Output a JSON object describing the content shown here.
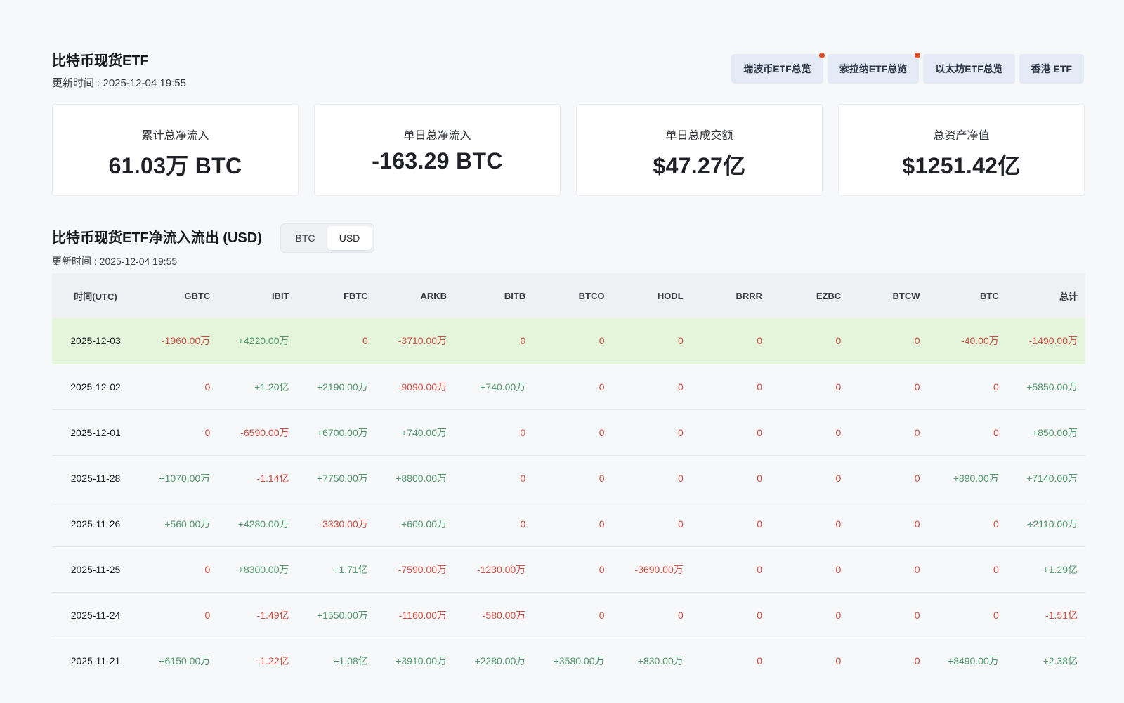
{
  "header": {
    "title": "比特币现货ETF",
    "update_time": "更新时间 : 2025-12-04 19:55"
  },
  "nav": [
    {
      "label": "瑞波币ETF总览",
      "dot": true
    },
    {
      "label": "索拉纳ETF总览",
      "dot": true
    },
    {
      "label": "以太坊ETF总览",
      "dot": false
    },
    {
      "label": "香港 ETF",
      "dot": false
    }
  ],
  "cards": [
    {
      "label": "累计总净流入",
      "value": "61.03万 BTC"
    },
    {
      "label": "单日总净流入",
      "value": "-163.29 BTC"
    },
    {
      "label": "单日总成交额",
      "value": "$47.27亿"
    },
    {
      "label": "总资产净值",
      "value": "$1251.42亿"
    }
  ],
  "flows": {
    "title": "比特币现货ETF净流入流出 (USD)",
    "toggle": [
      "BTC",
      "USD"
    ],
    "toggle_active": "USD",
    "update_time": "更新时间 : 2025-12-04 19:55",
    "columns": [
      "时间(UTC)",
      "GBTC",
      "IBIT",
      "FBTC",
      "ARKB",
      "BITB",
      "BTCO",
      "HODL",
      "BRRR",
      "EZBC",
      "BTCW",
      "BTC",
      "总计"
    ],
    "rows": [
      {
        "date": "2025-12-03",
        "highlight": true,
        "values": [
          "-1960.00万",
          "+4220.00万",
          "0",
          "-3710.00万",
          "0",
          "0",
          "0",
          "0",
          "0",
          "0",
          "-40.00万",
          "-1490.00万"
        ]
      },
      {
        "date": "2025-12-02",
        "highlight": false,
        "values": [
          "0",
          "+1.20亿",
          "+2190.00万",
          "-9090.00万",
          "+740.00万",
          "0",
          "0",
          "0",
          "0",
          "0",
          "0",
          "+5850.00万"
        ]
      },
      {
        "date": "2025-12-01",
        "highlight": false,
        "values": [
          "0",
          "-6590.00万",
          "+6700.00万",
          "+740.00万",
          "0",
          "0",
          "0",
          "0",
          "0",
          "0",
          "0",
          "+850.00万"
        ]
      },
      {
        "date": "2025-11-28",
        "highlight": false,
        "values": [
          "+1070.00万",
          "-1.14亿",
          "+7750.00万",
          "+8800.00万",
          "0",
          "0",
          "0",
          "0",
          "0",
          "0",
          "+890.00万",
          "+7140.00万"
        ]
      },
      {
        "date": "2025-11-26",
        "highlight": false,
        "values": [
          "+560.00万",
          "+4280.00万",
          "-3330.00万",
          "+600.00万",
          "0",
          "0",
          "0",
          "0",
          "0",
          "0",
          "0",
          "+2110.00万"
        ]
      },
      {
        "date": "2025-11-25",
        "highlight": false,
        "values": [
          "0",
          "+8300.00万",
          "+1.71亿",
          "-7590.00万",
          "-1230.00万",
          "0",
          "-3690.00万",
          "0",
          "0",
          "0",
          "0",
          "+1.29亿"
        ]
      },
      {
        "date": "2025-11-24",
        "highlight": false,
        "values": [
          "0",
          "-1.49亿",
          "+1550.00万",
          "-1160.00万",
          "-580.00万",
          "0",
          "0",
          "0",
          "0",
          "0",
          "0",
          "-1.51亿"
        ]
      },
      {
        "date": "2025-11-21",
        "highlight": false,
        "values": [
          "+6150.00万",
          "-1.22亿",
          "+1.08亿",
          "+3910.00万",
          "+2280.00万",
          "+3580.00万",
          "+830.00万",
          "0",
          "0",
          "0",
          "+8490.00万",
          "+2.38亿"
        ]
      }
    ]
  },
  "colors": {
    "positive": "#4f9a6c",
    "negative": "#cf4d40",
    "highlight_row": "#e4f5dc"
  }
}
